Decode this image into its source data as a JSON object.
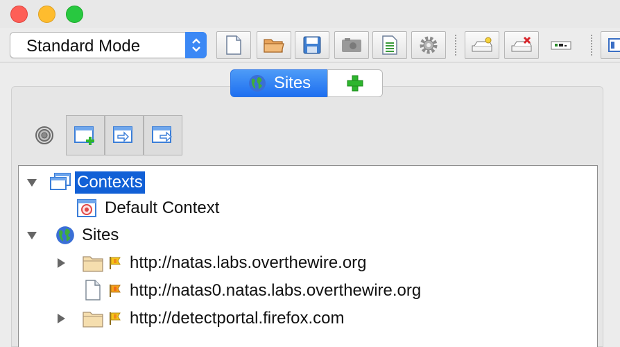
{
  "window": {
    "controls": [
      "close",
      "minimize",
      "maximize"
    ]
  },
  "toolbar": {
    "mode_selected": "Standard Mode",
    "buttons": [
      "new-session",
      "open-session",
      "save-session",
      "snapshot",
      "session-properties",
      "options",
      "break-on-request",
      "clear-breakpoint",
      "show-tab-bar",
      "layout"
    ]
  },
  "sites_panel": {
    "tab_label": "Sites",
    "add_tab_symbol": "+"
  },
  "tree": {
    "contexts": {
      "label": "Contexts",
      "children": [
        {
          "label": "Default Context"
        }
      ]
    },
    "sites": {
      "label": "Sites",
      "children": [
        {
          "label": "http://natas.labs.overthewire.org",
          "type": "folder"
        },
        {
          "label": "http://natas0.natas.labs.overthewire.org",
          "type": "page"
        },
        {
          "label": "http://detectportal.firefox.com",
          "type": "folder"
        }
      ]
    }
  },
  "colors": {
    "accent": "#1e6ff0",
    "selection": "#1160d6",
    "add_green": "#2db52d"
  }
}
